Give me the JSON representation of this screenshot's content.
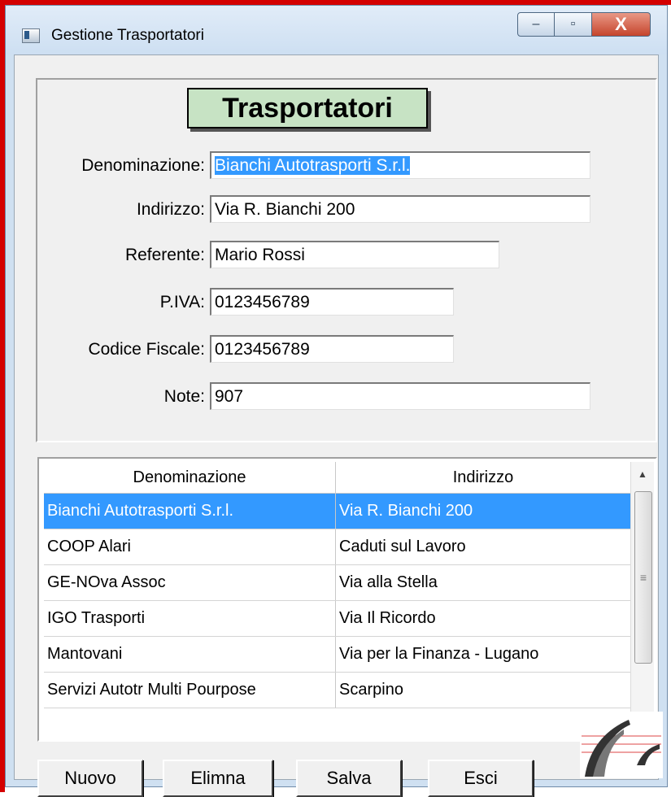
{
  "window": {
    "title": "Gestione Trasportatori",
    "buttons": {
      "minimize": "–",
      "maximize": "▫",
      "close": "X"
    }
  },
  "form": {
    "title": "Trasportatori",
    "fields": {
      "denominazione": {
        "label": "Denominazione:",
        "value": "Bianchi Autotrasporti S.r.l."
      },
      "indirizzo": {
        "label": "Indirizzo:",
        "value": "Via R. Bianchi 200"
      },
      "referente": {
        "label": "Referente:",
        "value": "Mario Rossi"
      },
      "piva": {
        "label": "P.IVA:",
        "value": "0123456789"
      },
      "codice_fiscale": {
        "label": "Codice Fiscale:",
        "value": "0123456789"
      },
      "note": {
        "label": "Note:",
        "value": "907"
      }
    }
  },
  "table": {
    "columns": [
      "Denominazione",
      "Indirizzo"
    ],
    "rows": [
      {
        "denominazione": "Bianchi Autotrasporti S.r.l.",
        "indirizzo": "Via R. Bianchi 200",
        "selected": true
      },
      {
        "denominazione": "COOP Alari",
        "indirizzo": "Caduti sul Lavoro"
      },
      {
        "denominazione": "GE-NOva Assoc",
        "indirizzo": "Via alla Stella"
      },
      {
        "denominazione": "IGO Trasporti",
        "indirizzo": "Via Il Ricordo"
      },
      {
        "denominazione": "Mantovani",
        "indirizzo": "Via per la Finanza - Lugano"
      },
      {
        "denominazione": "Servizi Autotr Multi Pourpose",
        "indirizzo": "Scarpino"
      }
    ]
  },
  "actions": {
    "nuovo": "Nuovo",
    "elimina": "Elimna",
    "salva": "Salva",
    "esci": "Esci"
  },
  "colors": {
    "selection": "#3399ff",
    "title_bg": "#c7e3c4",
    "frame_red": "#d40000"
  }
}
